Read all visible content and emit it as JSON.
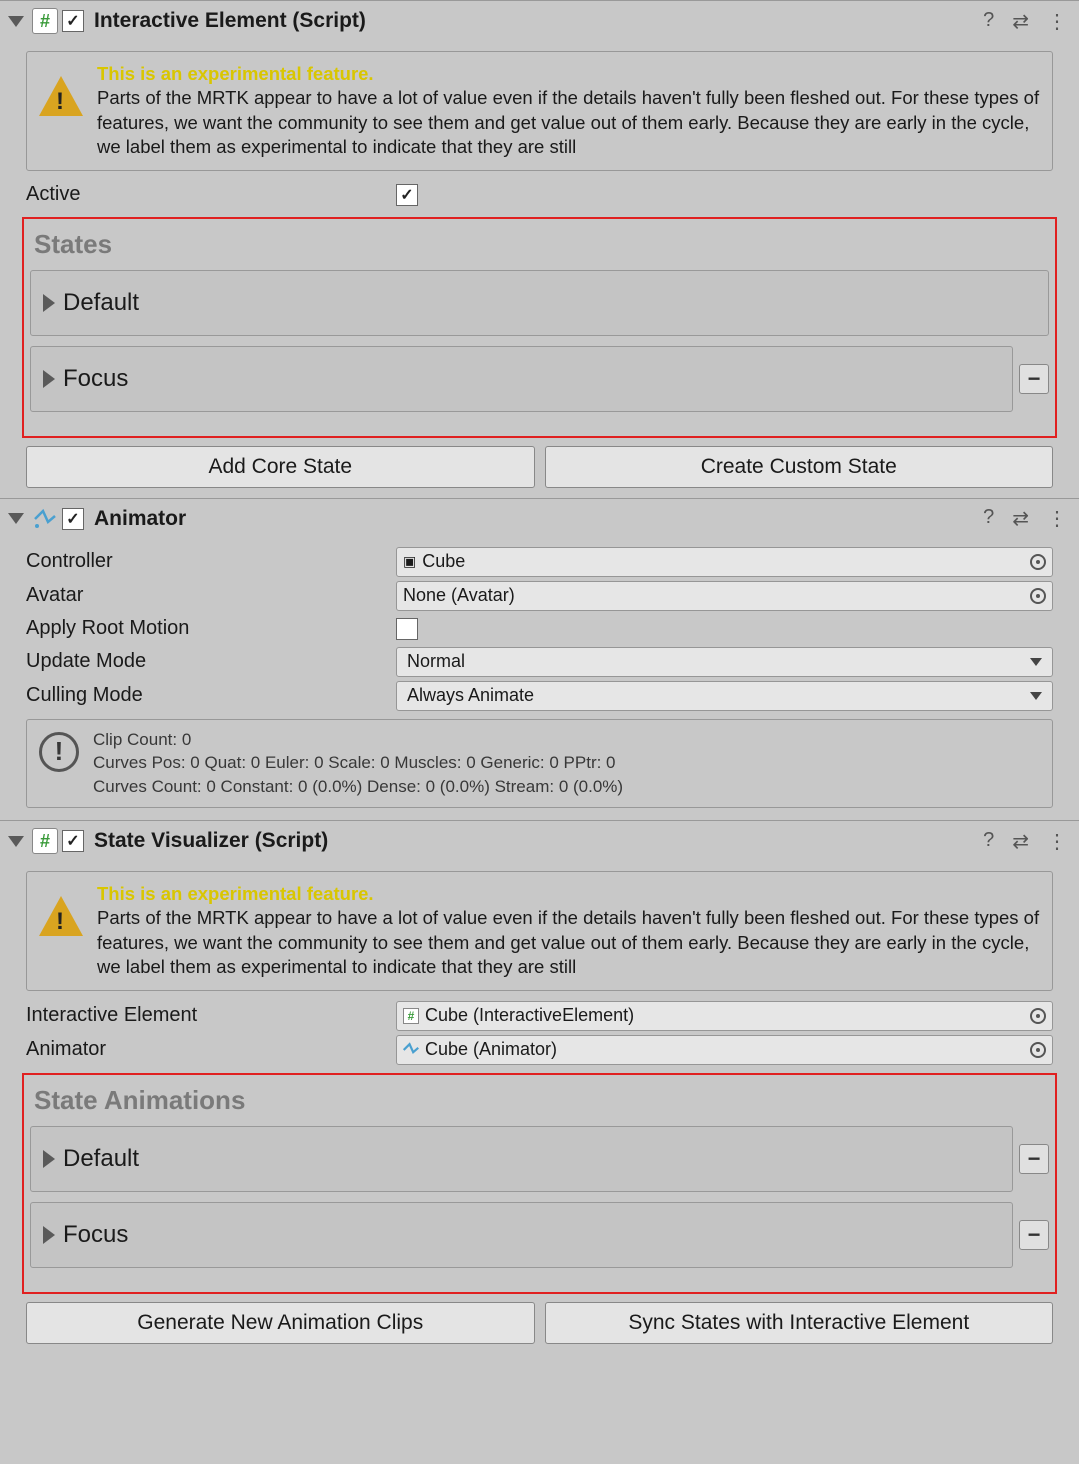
{
  "component1": {
    "title": "Interactive Element (Script)",
    "enabled": true,
    "warning": {
      "headline": "This is an experimental feature.",
      "body": "Parts of the MRTK appear to have a lot of value even if the details haven't fully been fleshed out. For these types of features, we want the community to see them and get value out of them early. Because they are early in the cycle, we label them as experimental to indicate that they are still"
    },
    "active_label": "Active",
    "states_title": "States",
    "states": [
      "Default",
      "Focus"
    ],
    "btn_add": "Add Core State",
    "btn_create": "Create Custom State"
  },
  "component2": {
    "title": "Animator",
    "enabled": true,
    "controller_label": "Controller",
    "controller_value": "Cube",
    "avatar_label": "Avatar",
    "avatar_value": "None (Avatar)",
    "apply_root_label": "Apply Root Motion",
    "update_mode_label": "Update Mode",
    "update_mode_value": "Normal",
    "culling_label": "Culling Mode",
    "culling_value": "Always Animate",
    "stats_line1": "Clip Count: 0",
    "stats_line2": "Curves Pos: 0 Quat: 0 Euler: 0 Scale: 0 Muscles: 0 Generic: 0 PPtr: 0",
    "stats_line3": "Curves Count: 0 Constant: 0 (0.0%) Dense: 0 (0.0%) Stream: 0 (0.0%)"
  },
  "component3": {
    "title": "State Visualizer (Script)",
    "enabled": true,
    "warning": {
      "headline": "This is an experimental feature.",
      "body": "Parts of the MRTK appear to have a lot of value even if the details haven't fully been fleshed out. For these types of features, we want the community to see them and get value out of them early. Because they are early in the cycle, we label them as experimental to indicate that they are still"
    },
    "ie_label": "Interactive Element",
    "ie_value": "Cube (InteractiveElement)",
    "anim_label": "Animator",
    "anim_value": "Cube (Animator)",
    "section_title": "State Animations",
    "states": [
      "Default",
      "Focus"
    ],
    "btn_gen": "Generate New Animation Clips",
    "btn_sync": "Sync States with Interactive Element"
  }
}
